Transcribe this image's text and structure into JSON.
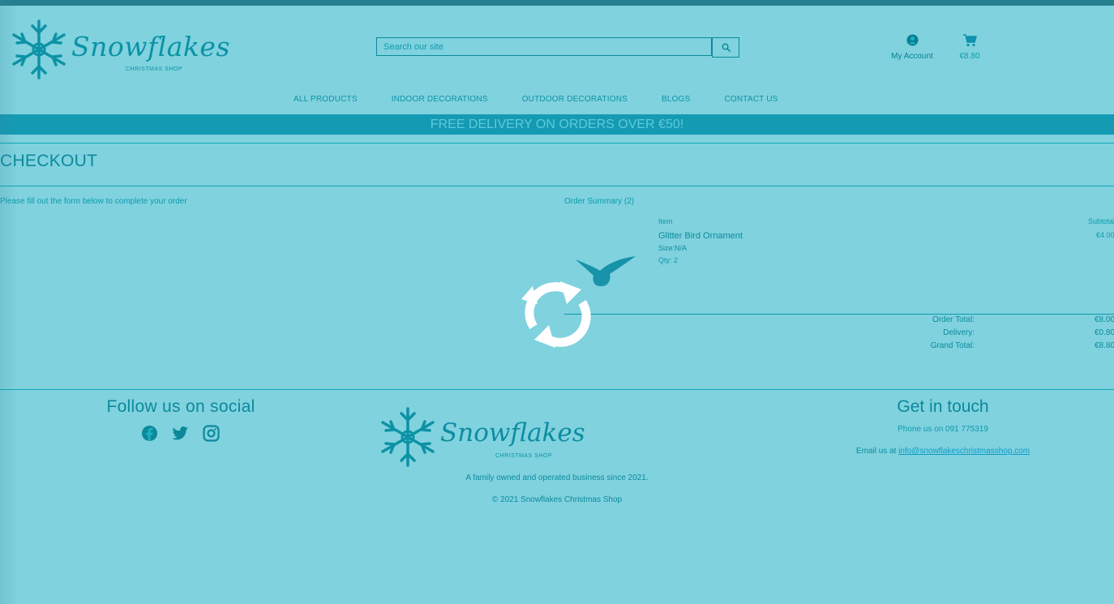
{
  "header": {
    "brand_name": "Snowflakes",
    "brand_sub": "CHRISTMAS SHOP",
    "search_placeholder": "Search our site",
    "account_label": "My Account",
    "cart_total": "€8.80"
  },
  "nav": {
    "items": [
      "ALL PRODUCTS",
      "INDOOR DECORATIONS",
      "OUTDOOR DECORATIONS",
      "BLOGS",
      "CONTACT US"
    ]
  },
  "banner": "FREE DELIVERY ON ORDERS OVER €50!",
  "page": {
    "title": "CHECKOUT",
    "intro": "Please fill out the form below to complete your order"
  },
  "summary": {
    "title": "Order Summary (2)",
    "col_item": "Item",
    "col_subtotal": "Subtotal",
    "item": {
      "name": "Glitter Bird Ornament",
      "size": "Size:N/A",
      "qty": "Qty: 2",
      "subtotal": "€4.00"
    },
    "totals": [
      {
        "label": "Order Total:",
        "value": "€8.00"
      },
      {
        "label": "Delivery:",
        "value": "€0.80"
      },
      {
        "label": "Grand Total:",
        "value": "€8.80"
      }
    ]
  },
  "footer": {
    "follow_title": "Follow us on social",
    "social_icons": [
      "facebook-icon",
      "twitter-icon",
      "instagram-icon"
    ],
    "brand_name": "Snowflakes",
    "brand_sub": "CHRISTMAS SHOP",
    "tagline": "A family owned and operated business since 2021.",
    "copyright": "© 2021 Snowflakes Christmas Shop",
    "contact_title": "Get in touch",
    "phone": "Phone us on 091 775319",
    "email_prefix": "Email us at",
    "email": "info@snowflakeschristmasshop.com"
  },
  "overlay": {
    "spinner_icon": "loading-spinner-icon"
  }
}
